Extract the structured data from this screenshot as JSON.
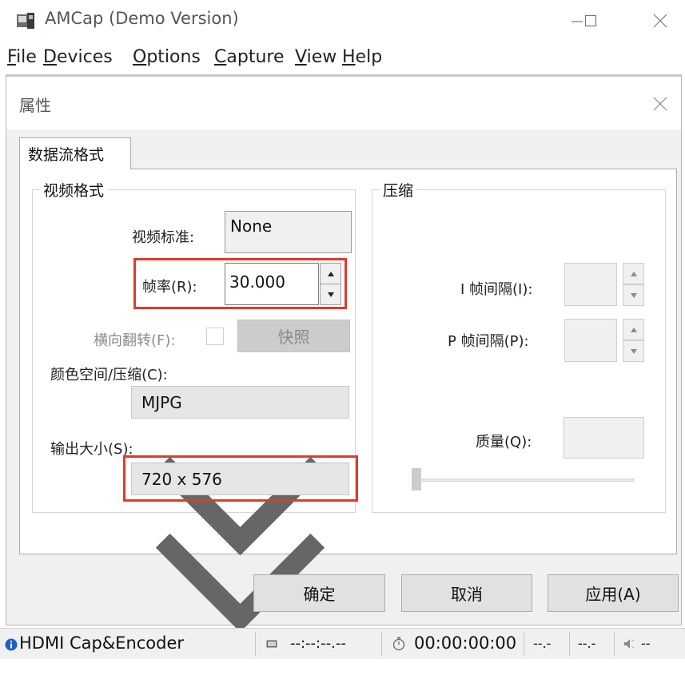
{
  "window": {
    "title": "AMCap (Demo Version)",
    "controls": {
      "minimize": "—",
      "maximize": "☐",
      "close": "✕"
    }
  },
  "menu": {
    "items": [
      {
        "mnemonic": "F",
        "rest": "ile"
      },
      {
        "mnemonic": "D",
        "rest": "evices"
      },
      {
        "mnemonic": "O",
        "rest": "ptions"
      },
      {
        "mnemonic": "C",
        "rest": "apture"
      },
      {
        "mnemonic": "V",
        "rest": "iew"
      },
      {
        "mnemonic": "H",
        "rest": "elp"
      }
    ]
  },
  "dialog": {
    "title": "属性",
    "tab": "数据流格式",
    "video_format": {
      "legend": "视频格式",
      "standard_label": "视频标准:",
      "standard_value": "None",
      "framerate_label": "帧率(R):",
      "framerate_value": "30.000",
      "flip_label": "横向翻转(F):",
      "snapshot_label": "快照",
      "color_space_label": "颜色空间/压缩(C):",
      "color_space_value": "MJPG",
      "output_size_label": "输出大小(S):",
      "output_size_value": "720 x 576"
    },
    "compression": {
      "legend": "压缩",
      "i_frame_label": "I 帧间隔(I):",
      "p_frame_label": "P 帧间隔(P):",
      "quality_label": "质量(Q):"
    },
    "buttons": {
      "ok": "确定",
      "cancel": "取消",
      "apply": "应用(A)"
    }
  },
  "status_bar": {
    "device": "HDMI Cap&Encoder",
    "timecode": "--:--:--.--",
    "elapsed": "00:00:00:00",
    "field3": "--.-",
    "field4": "--.-",
    "field5": "--"
  },
  "colors": {
    "highlight": "#e23a2a",
    "dialog_bg": "#f0f0f0",
    "button_bg": "#e1e1e1"
  }
}
